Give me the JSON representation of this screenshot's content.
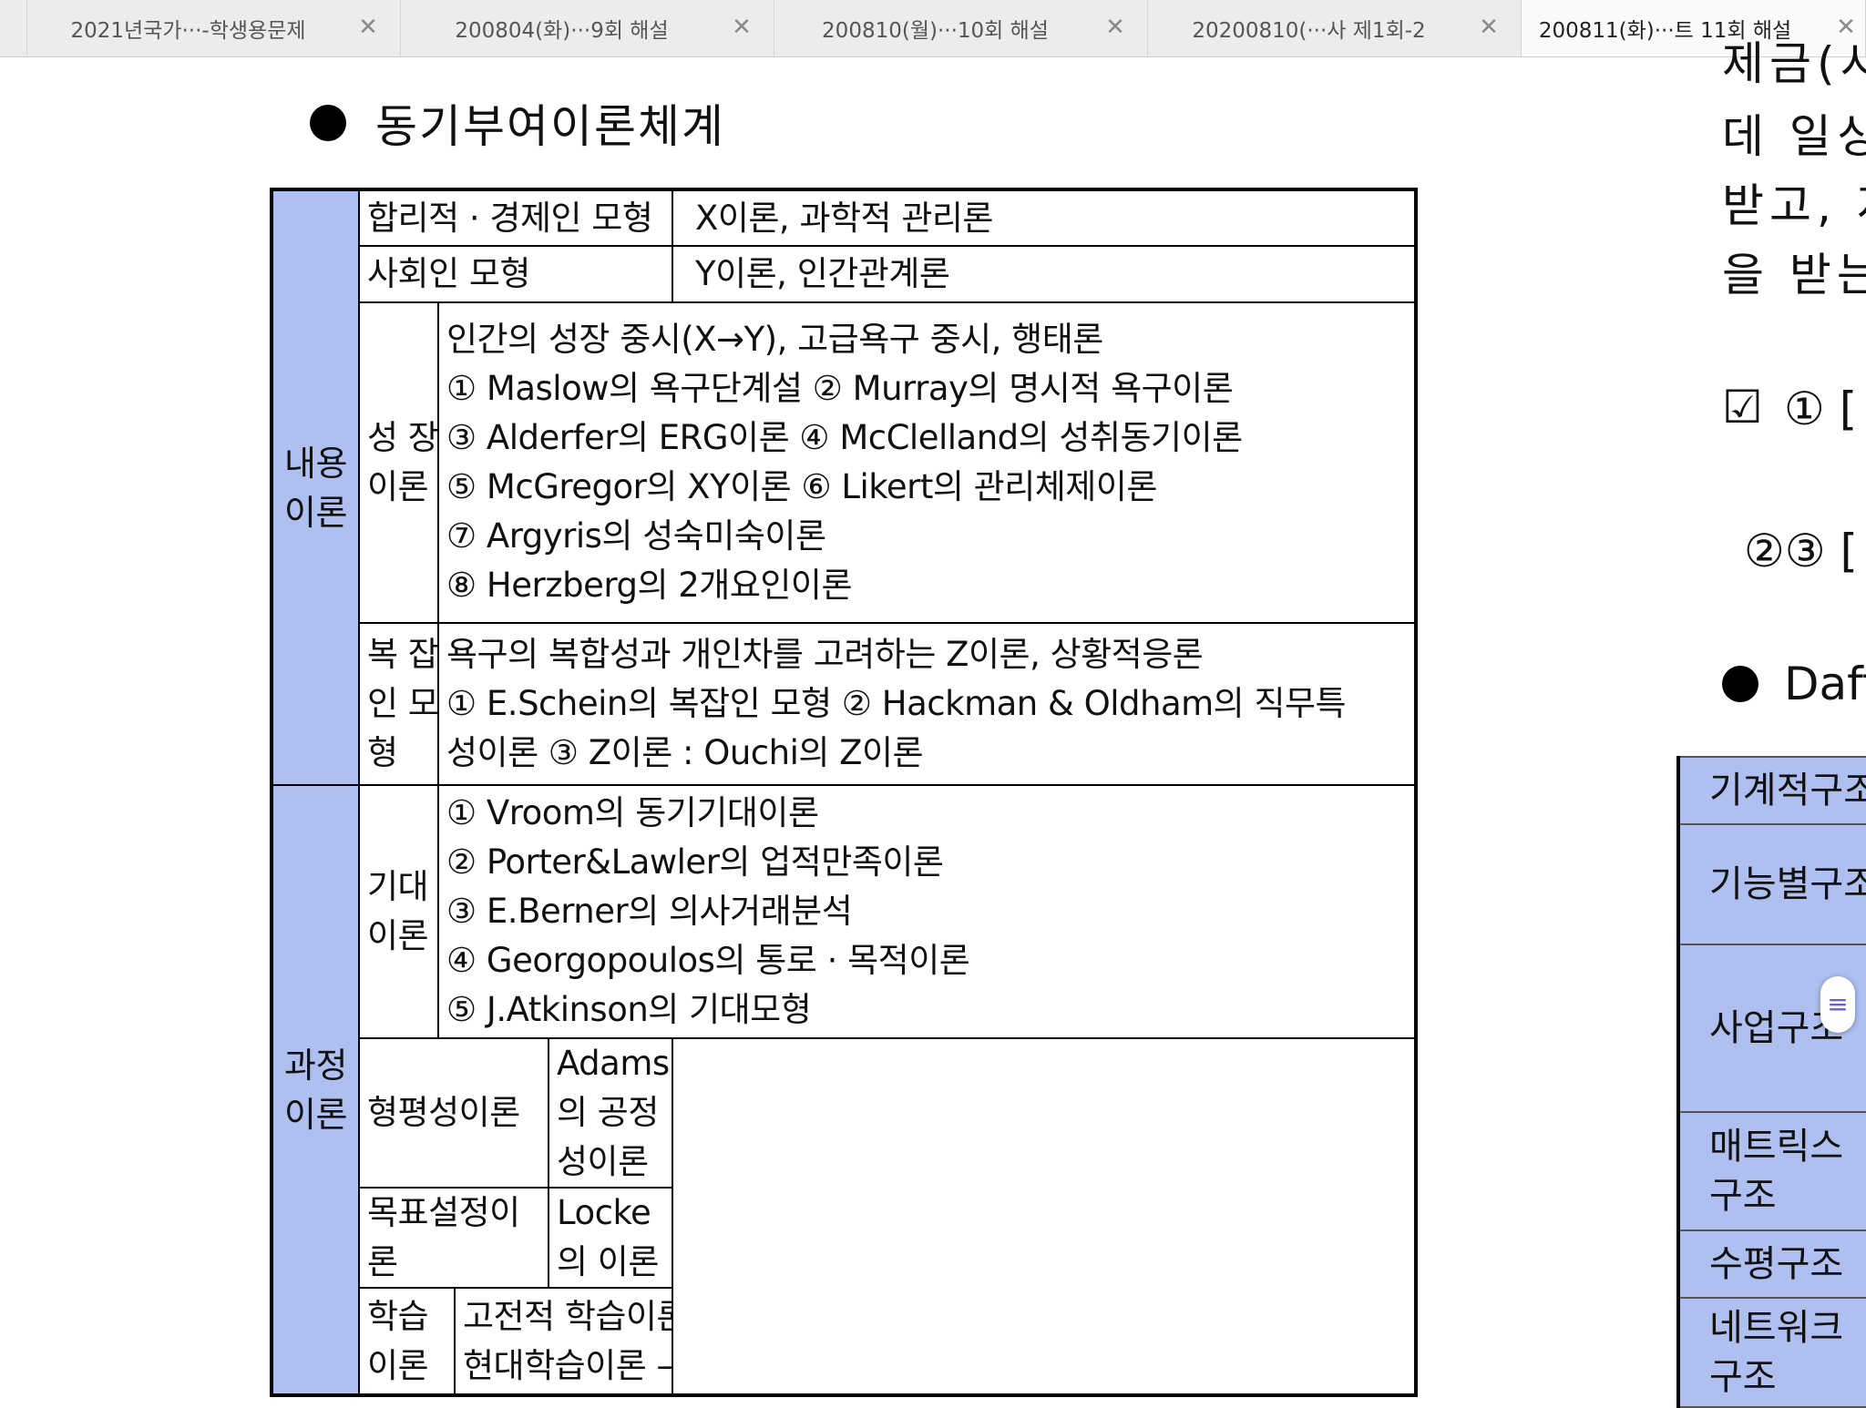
{
  "tabs": [
    {
      "title": "2021년국가···-학생용문제",
      "close": "✕"
    },
    {
      "title": "200804(화)···9회 해설",
      "close": "✕"
    },
    {
      "title": "200810(월)···10회 해설",
      "close": "✕"
    },
    {
      "title": "20200810(···사 제1회-2",
      "close": "✕"
    },
    {
      "title": "200811(화)···트 11회 해설",
      "close": "✕"
    }
  ],
  "doc": {
    "heading": "동기부여이론체계",
    "table": {
      "r1": {
        "left": "합리적 · 경제인 모형",
        "right": "X이론, 과학적 관리론"
      },
      "r2": {
        "left": "사회인 모형",
        "right": "Y이론, 인간관계론"
      },
      "content_label": [
        "내용",
        "이론"
      ],
      "growth": {
        "label": [
          "성 장",
          "이론"
        ],
        "lines": [
          "인간의 성장 중시(X→Y), 고급욕구 중시, 행태론",
          "① Maslow의 욕구단계설 ② Murray의 명시적 욕구이론",
          "③ Alderfer의 ERG이론 ④ McClelland의 성취동기이론",
          "⑤ McGregor의 XY이론   ⑥ Likert의 관리체제이론",
          "⑦ Argyris의 성숙미숙이론",
          "⑧ Herzberg의 2개요인이론"
        ]
      },
      "complex": {
        "label": [
          "복 잡",
          "인 모",
          "형"
        ],
        "lines": [
          "욕구의 복합성과 개인차를 고려하는 Z이론, 상황적응론",
          "① E.Schein의 복잡인 모형 ② Hackman & Oldham의 직무특",
          "성이론 ③ Z이론 : Ouchi의 Z이론"
        ]
      },
      "process_label": [
        "과정",
        "이론"
      ],
      "expectancy": {
        "label": [
          "기대",
          "이론"
        ],
        "lines": [
          "① Vroom의 동기기대이론",
          "② Porter&Lawler의 업적만족이론",
          "③ E.Berner의 의사거래분석",
          "④ Georgopoulos의 통로 · 목적이론",
          "⑤ J.Atkinson의 기대모형"
        ]
      },
      "equity": {
        "left": "형평성이론",
        "right": "Adams의 공정성이론"
      },
      "goal": {
        "left": "목표설정이론",
        "right": "Locke의 이론"
      },
      "learning": {
        "left": "학습이론",
        "lines": [
          "고전적 학습이론 – 조건화이론(Skinner의 강화이론)",
          "현대학습이론 – 자율학습이론(인지학습이론 등)"
        ]
      }
    }
  },
  "right_page": {
    "lines": [
      "제금(시",
      "데  일싱",
      "받고,  저",
      "을  받는"
    ],
    "check_mark": "☑",
    "check_label": "①  [",
    "item23": "②③  [",
    "heading": "Daft",
    "structures": [
      "기계적구조",
      "기능별구조",
      "사업구조",
      "매트릭스",
      "구조",
      "수평구조",
      "네트워크",
      "구조"
    ],
    "handle_icon": "≡"
  }
}
